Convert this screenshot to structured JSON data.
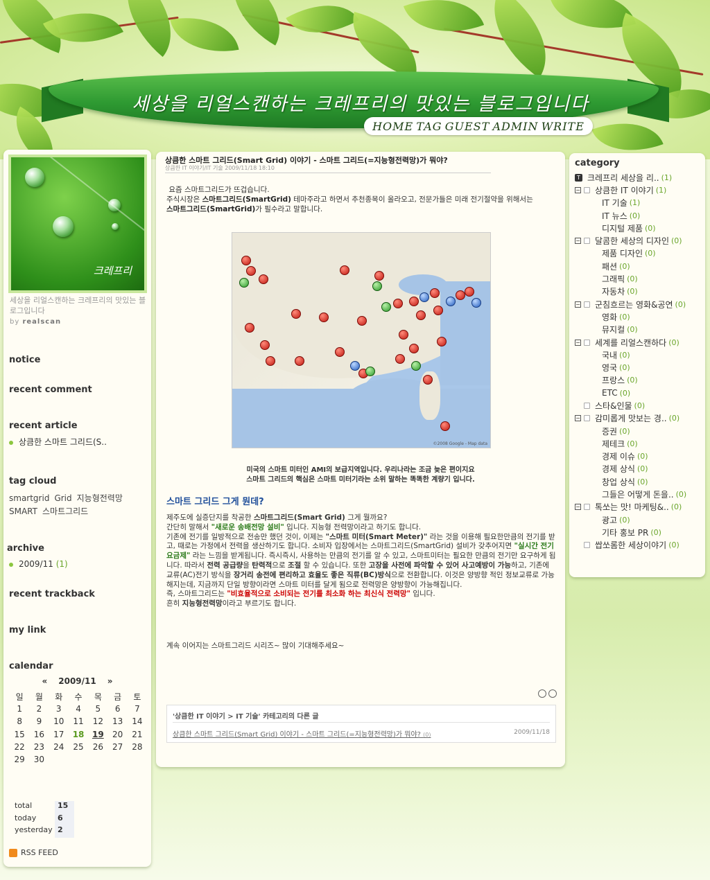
{
  "header": {
    "blog_title": "세상을 리얼스캔하는 크레프리의 맛있는 블로그입니다",
    "nav": [
      "HOME",
      "TAG",
      "GUEST",
      "ADMIN",
      "WRITE"
    ]
  },
  "profile": {
    "avatar_name": "크레프리",
    "description": "세상을 리얼스캔하는 크레프리의 맛있는 블로그입니다",
    "by": "by",
    "author": "realscan"
  },
  "sidebar": {
    "notice": "notice",
    "recent_comment": "recent comment",
    "recent_article": "recent article",
    "recent_article_item": "상큼한 스마트 그리드(S..",
    "tag_cloud": "tag cloud",
    "tags": [
      "smartgrid",
      "Grid",
      "지능형전력망",
      "SMART",
      "스마트그리드"
    ],
    "archive": "archive",
    "archive_item": "2009/11",
    "archive_count": "(1)",
    "recent_trackback": "recent trackback",
    "my_link": "my link",
    "calendar": "calendar",
    "cal_prev": "«",
    "cal_month": "2009/11",
    "cal_next": "»",
    "weekdays": [
      "일",
      "월",
      "화",
      "수",
      "목",
      "금",
      "토"
    ],
    "weeks": [
      [
        "1",
        "2",
        "3",
        "4",
        "5",
        "6",
        "7"
      ],
      [
        "8",
        "9",
        "10",
        "11",
        "12",
        "13",
        "14"
      ],
      [
        "15",
        "16",
        "17",
        "18",
        "19",
        "20",
        "21"
      ],
      [
        "22",
        "23",
        "24",
        "25",
        "26",
        "27",
        "28"
      ],
      [
        "29",
        "30",
        "",
        "",
        "",
        "",
        ""
      ]
    ],
    "stats": [
      {
        "k": "total",
        "v": "15"
      },
      {
        "k": "today",
        "v": "6"
      },
      {
        "k": "yesterday",
        "v": "2"
      }
    ],
    "rss": "RSS FEED"
  },
  "post": {
    "title": "상큼한 스마트 그리드(Smart Grid) 이야기 - 스마트 그리드(=지능형전력망)가 뭐야?",
    "meta": "상큼한 IT 이야기/IT 기술 2009/11/18 18:10",
    "p1": "요즘 스마트그리드가 뜨겁습니다.",
    "p2a": "주식시장은 ",
    "p2b": "스마트그리드(SmartGrid)",
    "p2c": " 테마주라고 하면서 추천종목이 올라오고, 전문가들은 미래 전기절약을 위해서는",
    "p3a": "스마트그리드(SmartGrid)",
    "p3b": "가 필수라고 말합니다.",
    "map_copy": "©2008 Google - Map data",
    "caption1": "미국의 스마트 미터인 AMI의 보급지역입니다. 우리나라는 조금 늦은 편이지요",
    "caption2": "스마트 그리드의 핵심은 스마트 미터기라는 소위 말하는 똑똑한 계량기 입니다.",
    "subtitle": "스마트 그리드 그게 뭔데?",
    "b1a": "제주도에 실증단지를 착공한 ",
    "b1b": "스마트그리드(Smart Grid)",
    "b1c": " 그게 뭘까요?",
    "b2a": "간단히 말해서 ",
    "b2b": "\"새로운 송배전망 설비\"",
    "b2c": " 입니다. 지능형 전력망이라고 하기도 합니다.",
    "b3a": "기존에 전기를 일방적으로 전송만 했던 것이, 이제는 ",
    "b3b": "\"스마트 미터(Smart Meter)\"",
    "b3c": " 라는 것을 이용해 필요한만큼의 전기를 받고, 때로는 가정에서 전력을 생산하기도 합니다. 소비자 입장에서는 스마트그리드(SmartGrid) 설비가 갖추어지면 ",
    "b3d": "\"실시간 전기요금제\"",
    "b3e": " 라는 느낌을 받게됩니다. 즉시즉시, 사용하는 만큼의 전기를 알 수 있고, 스마트미터는 필요한 만큼의 전기만 요구하게 됩니다. 따라서 ",
    "b3f": "전력 공급량",
    "b3g": "을 ",
    "b3h": "탄력적",
    "b3i": "으로 ",
    "b3j": "조절",
    "b3k": " 할 수 있습니다. 또한 ",
    "b3l": "고장을 사전에 파악할 수 있어 사고예방이 가능",
    "b3m": "하고, 기존에 교류(AC)전기 방식을 ",
    "b3n": "장거리 송전에 편리하고 효율도 좋은 직류(BC)방식",
    "b3o": "으로 전환합니다. 이것은 양방향 적인 정보교류로 가능해지는데, 지금까지 단일 방향이라면 스마트 미터를 달게 됨으로 전력망은 양방향이 가능해집니다.",
    "b4a": "즉, 스마트그리드는 ",
    "b4b": "\"비효율적으로 소비되는 전기를 최소화 하는 최신식 전력망\"",
    "b4c": " 입니다.",
    "b5a": "흔히 ",
    "b5b": "지능형전력망",
    "b5c": "이라고 부르기도 합니다.",
    "tail": "계속 이어지는 스마트그리드 시리즈~ 많이 기대해주세요~",
    "related_header": "'상큼한 IT 이야기 > IT 기술' 카테고리의 다른 글",
    "related_link": "상큼한 스마트 그리드(Smart Grid) 이야기 - 스마트 그리드(=지능형전력망)가 뭐야?",
    "related_count": "(0)",
    "related_date": "2009/11/18"
  },
  "category": {
    "title": "category",
    "items": [
      {
        "label": "크레프리 세상을 리..",
        "count": "(1)",
        "level": 0
      },
      {
        "label": "상큼한 IT 이야기",
        "count": "(1)",
        "level": 1
      },
      {
        "label": "IT 기술",
        "count": "(1)",
        "level": 2
      },
      {
        "label": "IT 뉴스",
        "count": "(0)",
        "level": 2
      },
      {
        "label": "디지털 제품",
        "count": "(0)",
        "level": 2
      },
      {
        "label": "달콤한 세상의 디자인",
        "count": "(0)",
        "level": 1
      },
      {
        "label": "제품 디자인",
        "count": "(0)",
        "level": 2
      },
      {
        "label": "패션",
        "count": "(0)",
        "level": 2
      },
      {
        "label": "그래픽",
        "count": "(0)",
        "level": 2
      },
      {
        "label": "자동차",
        "count": "(0)",
        "level": 2
      },
      {
        "label": "군침흐르는 영화&공연",
        "count": "(0)",
        "level": 1
      },
      {
        "label": "영화",
        "count": "(0)",
        "level": 2
      },
      {
        "label": "뮤지컬",
        "count": "(0)",
        "level": 2
      },
      {
        "label": "세계를 리얼스캔하다",
        "count": "(0)",
        "level": 1
      },
      {
        "label": "국내",
        "count": "(0)",
        "level": 2
      },
      {
        "label": "영국",
        "count": "(0)",
        "level": 2
      },
      {
        "label": "프랑스",
        "count": "(0)",
        "level": 2
      },
      {
        "label": "ETC",
        "count": "(0)",
        "level": 2
      },
      {
        "label": "스타&인물",
        "count": "(0)",
        "level": 3
      },
      {
        "label": "감미롭게 맛보는 경..",
        "count": "(0)",
        "level": 1
      },
      {
        "label": "증권",
        "count": "(0)",
        "level": 2
      },
      {
        "label": "제테크",
        "count": "(0)",
        "level": 2
      },
      {
        "label": "경제 이슈",
        "count": "(0)",
        "level": 2
      },
      {
        "label": "경제 상식",
        "count": "(0)",
        "level": 2
      },
      {
        "label": "창업 상식",
        "count": "(0)",
        "level": 2
      },
      {
        "label": "그들은 어떻게 돈을..",
        "count": "(0)",
        "level": 2
      },
      {
        "label": "톡쏘는 맛! 마케팅&..",
        "count": "(0)",
        "level": 1
      },
      {
        "label": "광고",
        "count": "(0)",
        "level": 2
      },
      {
        "label": "기타 홍보 PR",
        "count": "(0)",
        "level": 2
      },
      {
        "label": "쌉쏘롬한 세상이야기",
        "count": "(0)",
        "level": 3
      }
    ]
  }
}
